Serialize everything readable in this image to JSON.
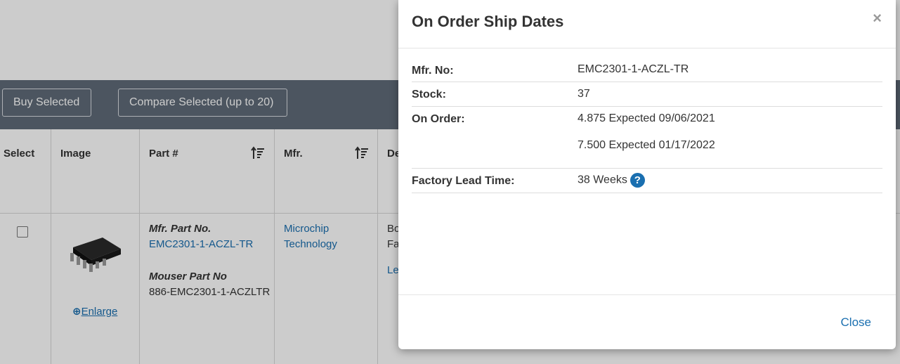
{
  "toolbar": {
    "buy_label": "Buy Selected",
    "compare_label": "Compare Selected (up to 20)"
  },
  "table": {
    "headers": {
      "select": "Select",
      "image": "Image",
      "part": "Part #",
      "mfr": "Mfr.",
      "desc": "De"
    },
    "row": {
      "mfr_part_label": "Mfr. Part No.",
      "mfr_part_no": "EMC2301-1-ACZL-TR",
      "mouser_part_label": "Mouser Part No",
      "mouser_part_no": "886-EMC2301-1-ACZLTR",
      "manufacturer_line1": "Microchip",
      "manufacturer_line2": "Technology",
      "desc_line1": "Bo",
      "desc_line2": "Fa",
      "desc_link": "Le",
      "enlarge_label": "Enlarge"
    }
  },
  "modal": {
    "title": "On Order Ship Dates",
    "close_x": "×",
    "rows": {
      "mfr_no": {
        "label": "Mfr. No:",
        "value": "EMC2301-1-ACZL-TR"
      },
      "stock": {
        "label": "Stock:",
        "value": "37"
      },
      "on_order": {
        "label": "On Order:",
        "entries": [
          "4.875 Expected 09/06/2021",
          "7.500 Expected 01/17/2022"
        ]
      },
      "lead_time": {
        "label": "Factory Lead Time:",
        "value": "38 Weeks",
        "help_icon": "?"
      }
    },
    "close_label": "Close"
  }
}
